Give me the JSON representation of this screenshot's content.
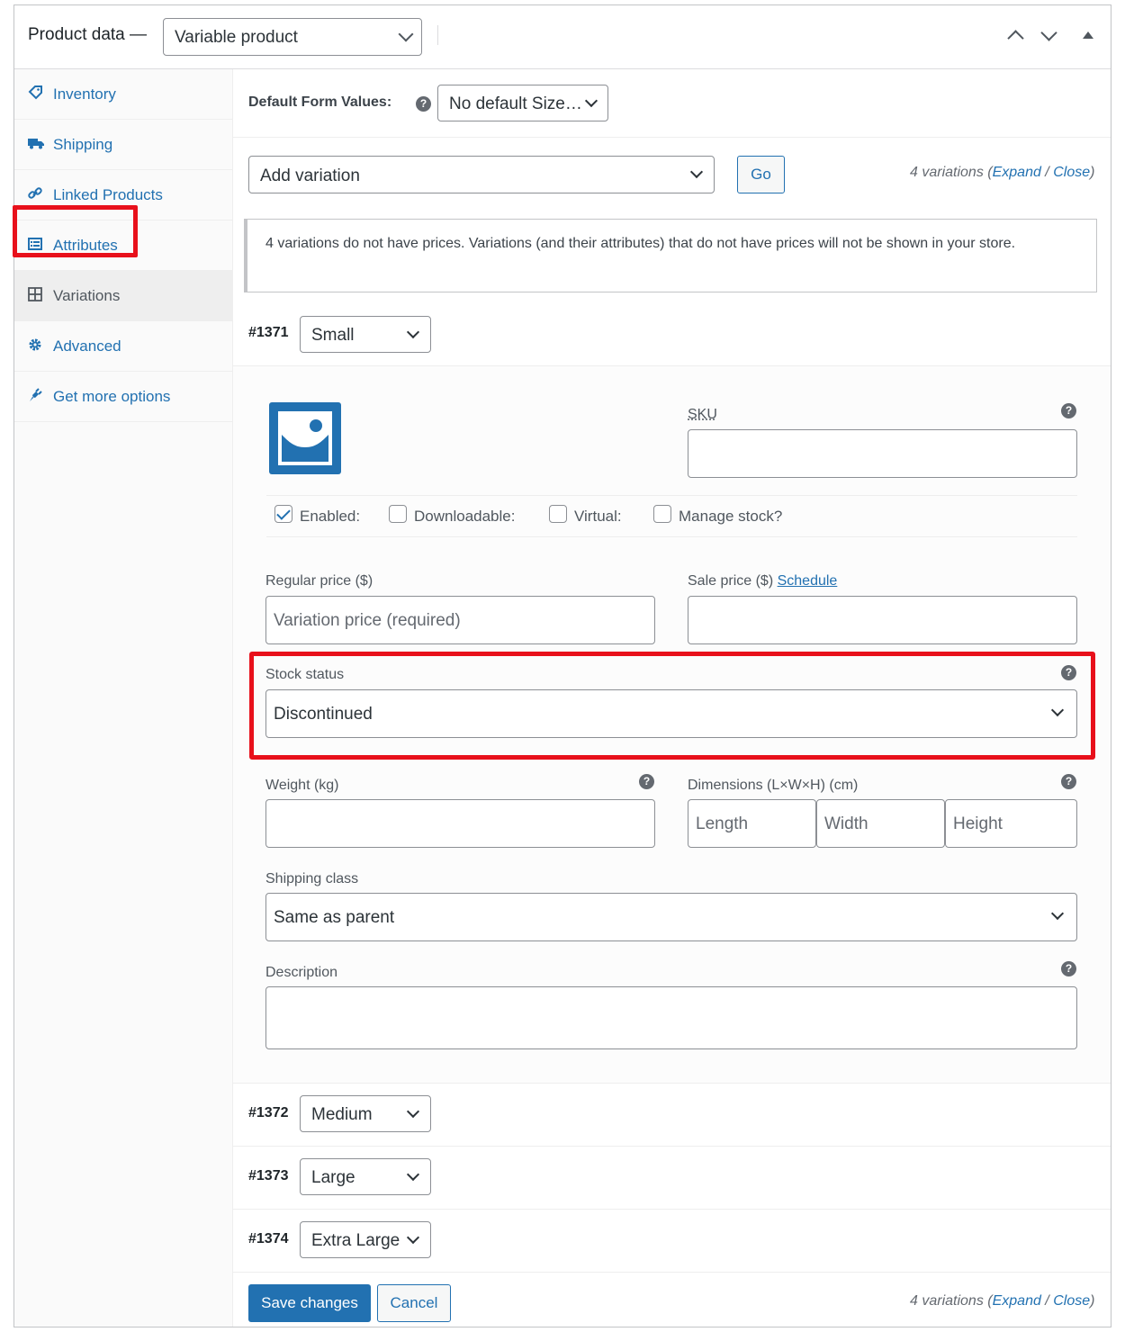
{
  "header": {
    "title": "Product data —",
    "product_type": "Variable product"
  },
  "sidebar": {
    "items": [
      {
        "label": "Inventory",
        "icon": "tag-icon"
      },
      {
        "label": "Shipping",
        "icon": "truck-icon"
      },
      {
        "label": "Linked Products",
        "icon": "link-icon"
      },
      {
        "label": "Attributes",
        "icon": "list-icon"
      },
      {
        "label": "Variations",
        "icon": "grid-icon"
      },
      {
        "label": "Advanced",
        "icon": "gear-icon"
      },
      {
        "label": "Get more options",
        "icon": "plugin-icon"
      }
    ],
    "active": "Variations"
  },
  "defaults": {
    "label": "Default Form Values:",
    "value": "No default Size…"
  },
  "variation_actions": {
    "add_variation": "Add variation",
    "go": "Go",
    "count_text": "4 variations (",
    "expand": "Expand",
    "separator": " / ",
    "close": "Close",
    "close_paren": ")"
  },
  "notice": "4 variations do not have prices. Variations (and their attributes) that do not have prices will not be shown in your store.",
  "variations": [
    {
      "id": "#1371",
      "size": "Small"
    },
    {
      "id": "#1372",
      "size": "Medium"
    },
    {
      "id": "#1373",
      "size": "Large"
    },
    {
      "id": "#1374",
      "size": "Extra Large"
    }
  ],
  "panel": {
    "sku_label": "SKU",
    "checkboxes": [
      {
        "label": "Enabled:",
        "checked": true
      },
      {
        "label": "Downloadable:",
        "checked": false
      },
      {
        "label": "Virtual:",
        "checked": false
      },
      {
        "label": "Manage stock?",
        "checked": false
      }
    ],
    "regular_price_label": "Regular price ($)",
    "regular_price_placeholder": "Variation price (required)",
    "sale_price_label": "Sale price ($)",
    "schedule_link": "Schedule",
    "stock_status_label": "Stock status",
    "stock_status_value": "Discontinued",
    "weight_label": "Weight (kg)",
    "dimensions_label": "Dimensions (L×W×H) (cm)",
    "length_placeholder": "Length",
    "width_placeholder": "Width",
    "height_placeholder": "Height",
    "shipping_class_label": "Shipping class",
    "shipping_class_value": "Same as parent",
    "description_label": "Description"
  },
  "footer": {
    "save": "Save changes",
    "cancel": "Cancel"
  },
  "colors": {
    "accent": "#2271b1",
    "highlight_box": "#e8101b"
  }
}
